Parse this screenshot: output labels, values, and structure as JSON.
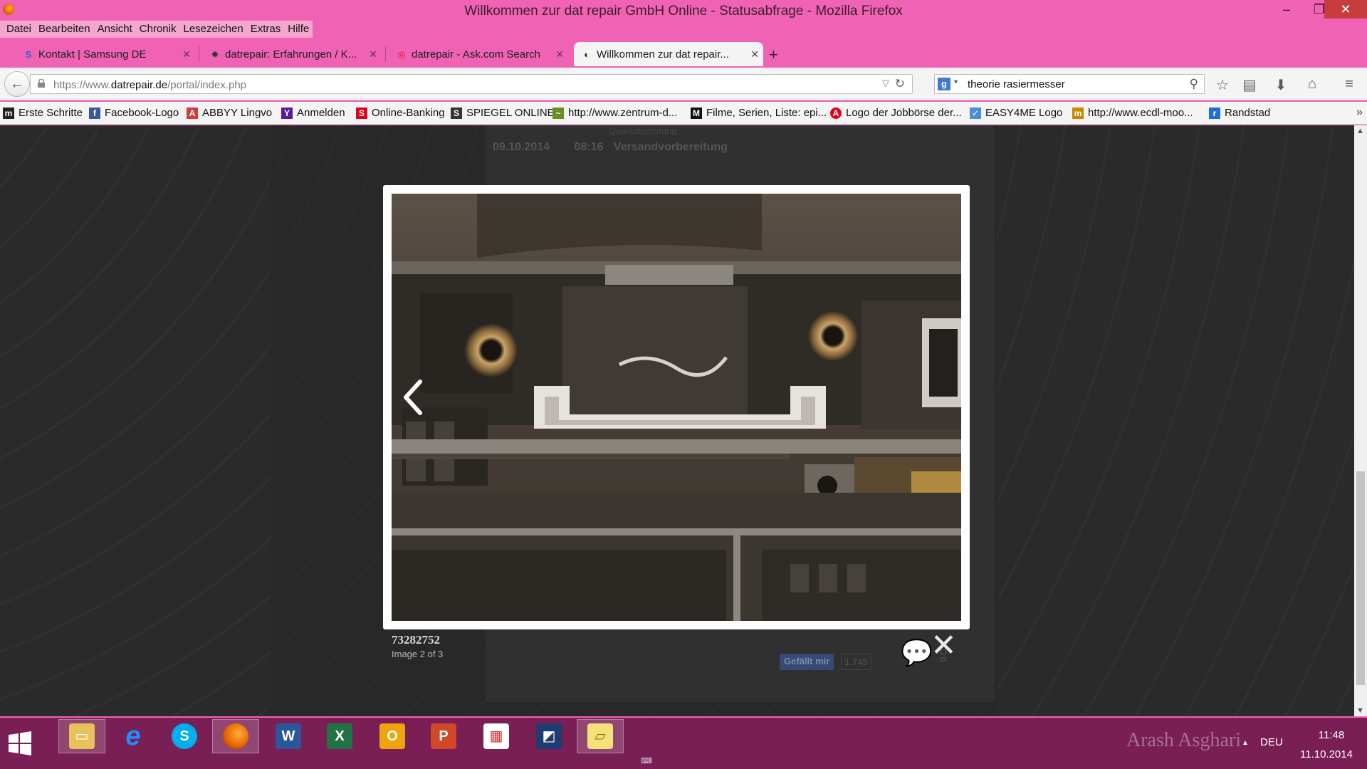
{
  "window": {
    "title": "Willkommen zur dat repair GmbH Online - Statusabfrage - Mozilla Firefox",
    "min": "–",
    "max": "❐",
    "close": "✕"
  },
  "menu": [
    "Datei",
    "Bearbeiten",
    "Ansicht",
    "Chronik",
    "Lesezeichen",
    "Extras",
    "Hilfe"
  ],
  "tabs": [
    {
      "label": "Kontakt | Samsung DE",
      "icon": "S",
      "icon_color": "#3b5bdb",
      "close": "✕"
    },
    {
      "label": "datrepair: Erfahrungen / K...",
      "icon": "✹",
      "icon_color": "#333333",
      "close": "✕"
    },
    {
      "label": "datrepair - Ask.com Search",
      "icon": "◎",
      "icon_color": "#d91a2a",
      "close": "✕"
    },
    {
      "label": "Willkommen zur dat repair...",
      "icon": "◐",
      "icon_color": "#222222",
      "close": "✕"
    }
  ],
  "new_tab": "+",
  "nav": {
    "back": "←",
    "url_prefix": "https://www.",
    "url_domain": "datrepair.de",
    "url_path": "/portal/index.php",
    "url_dropdown": "▽",
    "reload": "↻",
    "search_engine": "g",
    "search_engine_arrow": "▾",
    "search_query": "theorie rasiermesser",
    "search_icon": "⚲",
    "bookmark_star": "☆",
    "reading_list": "▤",
    "download": "⬇",
    "home": "⌂",
    "menu": "≡"
  },
  "bookmarks": [
    {
      "label": "Erste Schritte",
      "icon": "m",
      "color": "#222222"
    },
    {
      "label": "Facebook-Logo",
      "icon": "f",
      "color": "#3b5998"
    },
    {
      "label": "ABBYY Lingvo",
      "icon": "A",
      "color": "#d43b3b"
    },
    {
      "label": "Anmelden",
      "icon": "Y",
      "color": "#5a1a9a"
    },
    {
      "label": "Online-Banking",
      "icon": "S",
      "color": "#e2001a"
    },
    {
      "label": "SPIEGEL ONLINE",
      "icon": "S",
      "color": "#333333"
    },
    {
      "label": "http://www.zentrum-d...",
      "icon": "~",
      "color": "#6b8e23"
    },
    {
      "label": "Filme, Serien, Liste: epi...",
      "icon": "M",
      "color": "#111111"
    },
    {
      "label": "Logo der Jobbörse der...",
      "icon": "A",
      "color": "#e2001a"
    },
    {
      "label": "EASY4ME Logo",
      "icon": "✓",
      "color": "#4a90d9"
    },
    {
      "label": "http://www.ecdl-moo...",
      "icon": "m",
      "color": "#c58b00"
    },
    {
      "label": "Randstad",
      "icon": "r",
      "color": "#1f6fd0"
    }
  ],
  "bookmarks_more": "»",
  "page": {
    "faded_line": "Qualitätsprüfung",
    "status_date": "09.10.2014",
    "status_time": "08:16",
    "status_text": "Versandvorbereitung",
    "like_label": "Gefällt mir",
    "like_count": "1.745"
  },
  "lightbox": {
    "title": "73282752",
    "counter": "Image 2 of 3",
    "close": "✕"
  },
  "taskbar": {
    "apps": [
      {
        "name": "file-explorer",
        "glyph": "▭",
        "bg": "#e8c15a",
        "active": true
      },
      {
        "name": "internet-explorer",
        "glyph": "e",
        "bg": "#1e90ff",
        "active": false
      },
      {
        "name": "skype",
        "glyph": "S",
        "bg": "#00aff0",
        "active": false
      },
      {
        "name": "firefox",
        "glyph": "●",
        "bg": "#e66000",
        "active": true
      },
      {
        "name": "word",
        "glyph": "W",
        "bg": "#2b579a",
        "active": false
      },
      {
        "name": "excel",
        "glyph": "X",
        "bg": "#217346",
        "active": false
      },
      {
        "name": "outlook",
        "glyph": "O",
        "bg": "#f0a30a",
        "active": false
      },
      {
        "name": "powerpoint",
        "glyph": "P",
        "bg": "#d24726",
        "active": false
      },
      {
        "name": "app-puzzle",
        "glyph": "▦",
        "bg": "#ffffff",
        "active": false
      },
      {
        "name": "app-photo",
        "glyph": "◩",
        "bg": "#1e3c72",
        "active": false
      },
      {
        "name": "sticky-notes",
        "glyph": "▱",
        "bg": "#f3e27a",
        "active": true
      }
    ],
    "user": "Arash Asghari",
    "tray_arrow": "▲",
    "language": "DEU",
    "time": "11:48",
    "date": "11.10.2014",
    "keyboard": "⌨"
  }
}
